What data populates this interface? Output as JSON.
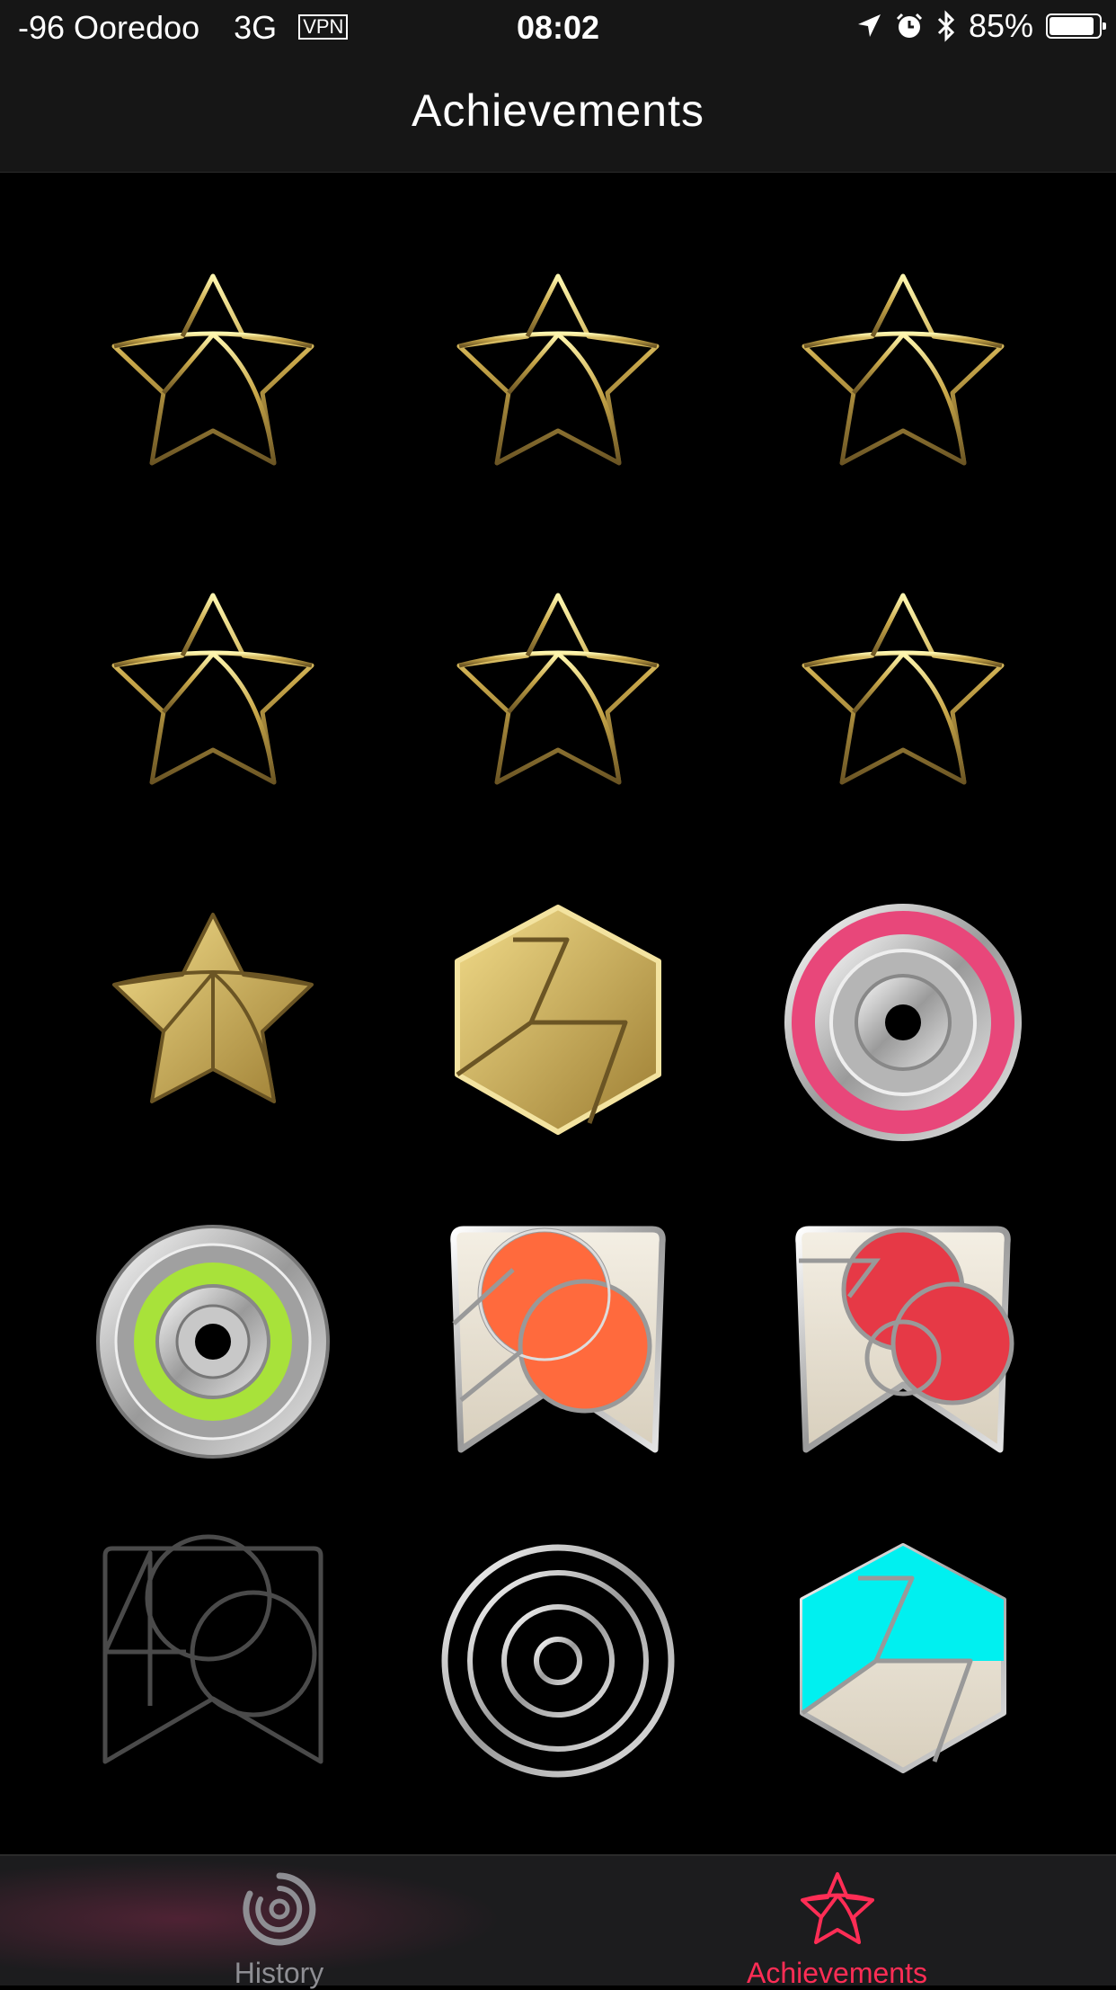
{
  "status_bar": {
    "carrier": "-96 Ooredoo",
    "network": "3G",
    "vpn": "VPN",
    "time": "08:02",
    "battery": "85%",
    "battery_level": 0.85
  },
  "nav": {
    "title": "Achievements"
  },
  "badges": [
    {
      "type": "gold-star-outline"
    },
    {
      "type": "gold-star-outline"
    },
    {
      "type": "gold-star-outline"
    },
    {
      "type": "gold-star-outline"
    },
    {
      "type": "gold-star-outline"
    },
    {
      "type": "gold-star-outline"
    },
    {
      "type": "gold-star-filled"
    },
    {
      "type": "gold-hexagon-seven"
    },
    {
      "type": "pink-ring-disc"
    },
    {
      "type": "green-ring-disc"
    },
    {
      "type": "orange-circles-shield"
    },
    {
      "type": "red-circles-shield"
    },
    {
      "type": "locked-square-outline"
    },
    {
      "type": "locked-ring-outline"
    },
    {
      "type": "cyan-hexagon-seven"
    }
  ],
  "tabs": [
    {
      "label": "History",
      "icon": "history-rings-icon",
      "active": false
    },
    {
      "label": "Achievements",
      "icon": "achievements-star-icon",
      "active": true
    }
  ],
  "colors": {
    "active_tint": "#ff2d55",
    "gold": "#c9a84a",
    "pink": "#e8477a",
    "green": "#a8e23a",
    "orange": "#ff6a3d",
    "red": "#e63946",
    "cyan": "#00f0f0"
  }
}
